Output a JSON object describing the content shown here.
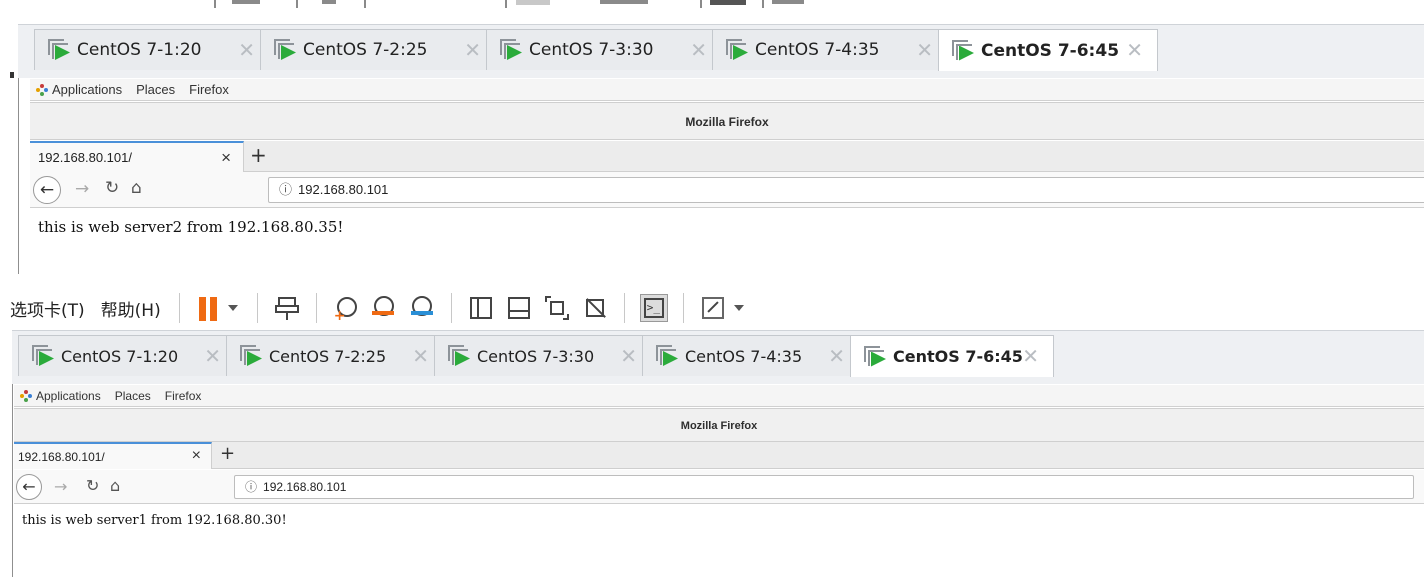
{
  "vmware_toolbar": {
    "menu_tabs": "选项卡(T)",
    "menu_help": "帮助(H)",
    "icons": [
      "pause-icon",
      "dropdown-caret-icon",
      "send-ctrl-alt-del-icon",
      "snapshot-take-icon",
      "snapshot-revert-icon",
      "snapshot-manager-icon",
      "view-sidebar-icon",
      "view-thumbnail-icon",
      "fit-guest-icon",
      "no-stretch-icon",
      "console-icon",
      "fullscreen-icon",
      "dropdown-caret-icon"
    ]
  },
  "top_window": {
    "vm_tabs": [
      {
        "label": "CentOS 7-1:20"
      },
      {
        "label": "CentOS 7-2:25"
      },
      {
        "label": "CentOS 7-3:30"
      },
      {
        "label": "CentOS 7-4:35"
      },
      {
        "label": "CentOS 7-6:45",
        "active": true
      }
    ],
    "gnome": {
      "applications": "Applications",
      "places": "Places",
      "firefox": "Firefox"
    },
    "firefox": {
      "window_title": "Mozilla Firefox",
      "tab_title": "192.168.80.101/",
      "tab_close": "×",
      "new_tab": "+",
      "url": "192.168.80.101",
      "page_text": "this is web server2 from 192.168.80.35!"
    }
  },
  "bottom_window": {
    "vm_tabs": [
      {
        "label": "CentOS 7-1:20"
      },
      {
        "label": "CentOS 7-2:25"
      },
      {
        "label": "CentOS 7-3:30"
      },
      {
        "label": "CentOS 7-4:35"
      },
      {
        "label": "CentOS 7-6:45",
        "active": true
      }
    ],
    "gnome": {
      "applications": "Applications",
      "places": "Places",
      "firefox": "Firefox"
    },
    "firefox": {
      "window_title": "Mozilla Firefox",
      "tab_title": "192.168.80.101/",
      "tab_close": "×",
      "new_tab": "+",
      "url": "192.168.80.101",
      "page_text": "this is web server1 from 192.168.80.30!"
    }
  },
  "colors": {
    "pause": "#ef6a13",
    "play": "#2bab3b",
    "tab_accent": "#4a90d9"
  }
}
